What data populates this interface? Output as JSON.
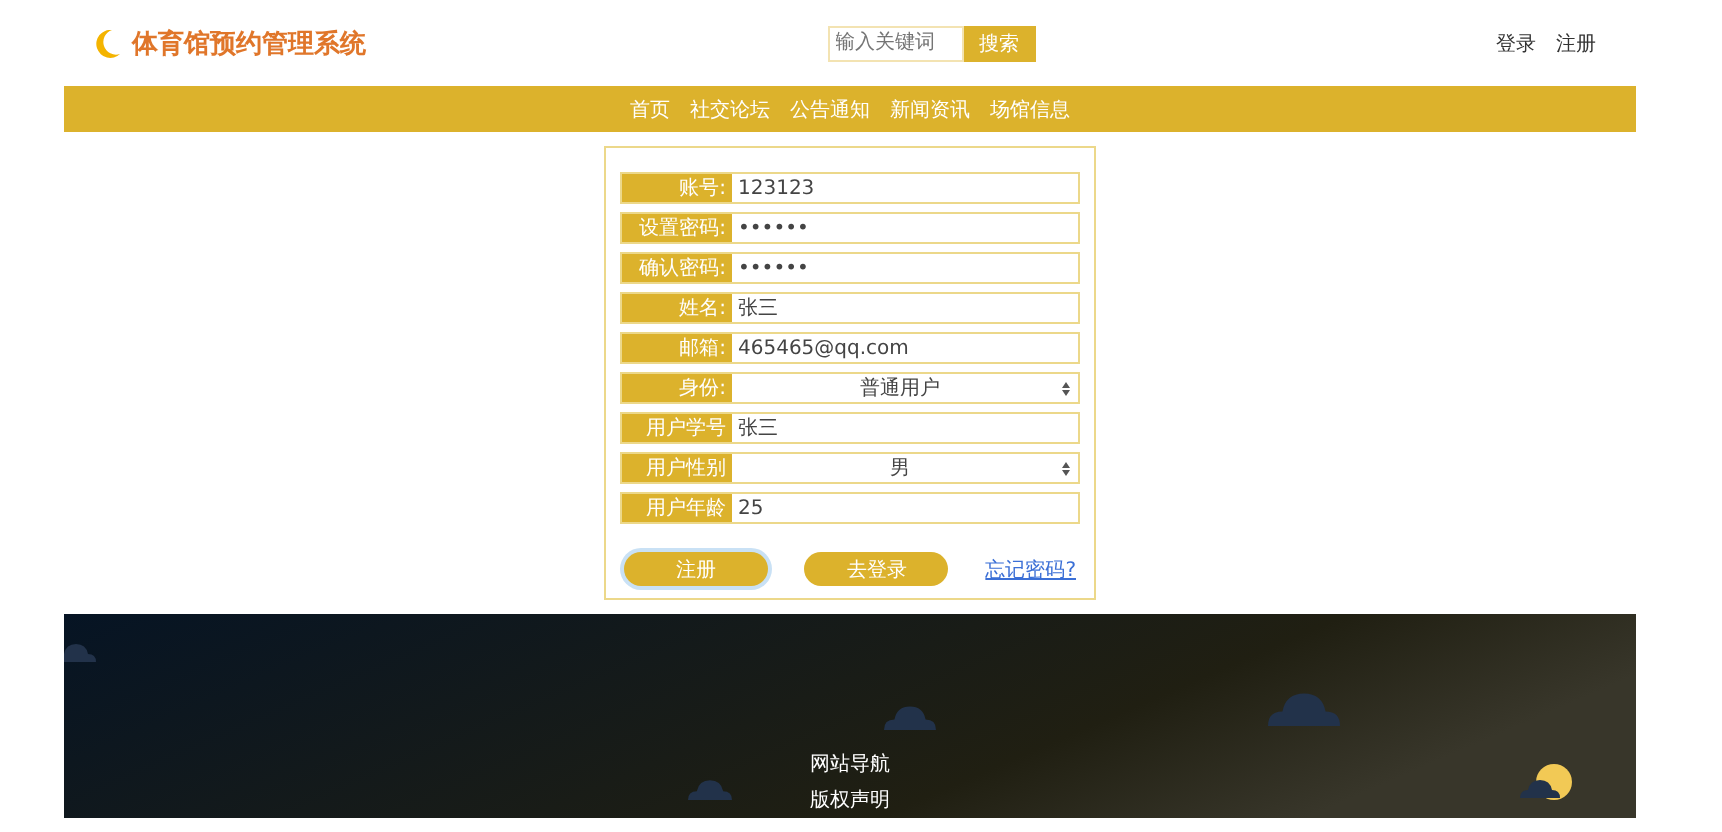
{
  "header": {
    "logo": "体育馆预约管理系统",
    "search": {
      "placeholder": "输入关键词",
      "button": "搜索"
    },
    "links": [
      "登录",
      "注册"
    ]
  },
  "nav": {
    "items": [
      "首页",
      "社交论坛",
      "公告通知",
      "新闻资讯",
      "场馆信息"
    ]
  },
  "form": {
    "fields": [
      {
        "kind": "text",
        "label": "账号:",
        "value": "123123"
      },
      {
        "kind": "text",
        "label": "设置密码:",
        "value": "••••••"
      },
      {
        "kind": "text",
        "label": "确认密码:",
        "value": "••••••"
      },
      {
        "kind": "text",
        "label": "姓名:",
        "value": "张三"
      },
      {
        "kind": "text",
        "label": "邮箱:",
        "value": "465465@qq.com"
      },
      {
        "kind": "select",
        "label": "身份:",
        "value": "普通用户"
      },
      {
        "kind": "text",
        "label": "用户学号",
        "value": "张三"
      },
      {
        "kind": "select",
        "label": "用户性别",
        "value": "男"
      },
      {
        "kind": "text",
        "label": "用户年龄",
        "value": "25"
      }
    ],
    "buttons": [
      {
        "label": "注册",
        "focused": true
      },
      {
        "label": "去登录",
        "focused": false
      }
    ],
    "link": "忘记密码?"
  },
  "footer": {
    "links": [
      "网站导航",
      "版权声明"
    ]
  }
}
